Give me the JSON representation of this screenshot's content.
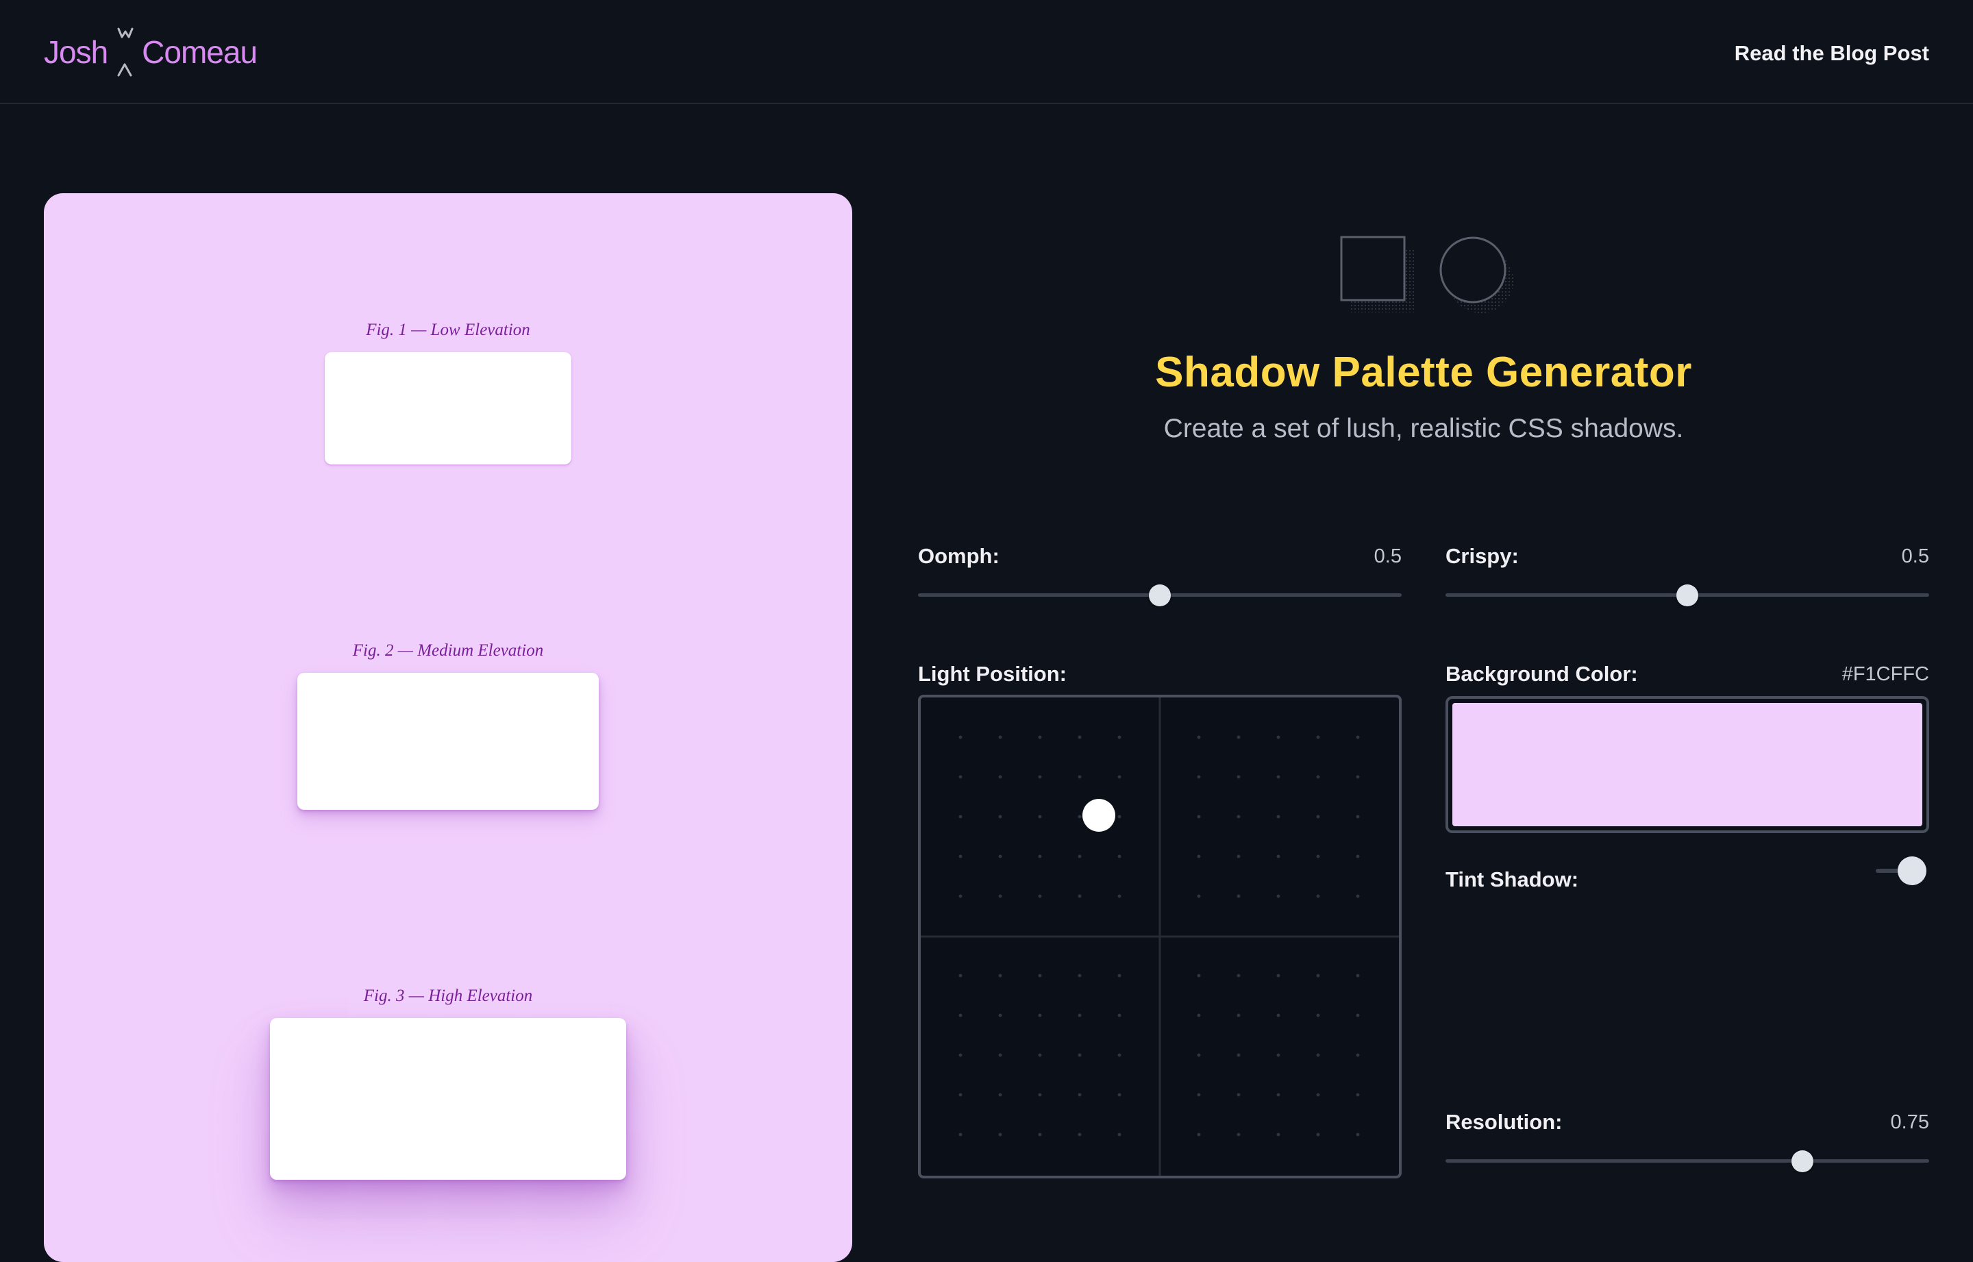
{
  "header": {
    "logo_first": "Josh",
    "logo_last": "Comeau",
    "nav_link": "Read the Blog Post"
  },
  "preview": {
    "background": "#F1CFFC",
    "figures": [
      {
        "caption": "Fig. 1 — Low Elevation"
      },
      {
        "caption": "Fig. 2 — Medium Elevation"
      },
      {
        "caption": "Fig. 3 — High Elevation"
      }
    ]
  },
  "hero": {
    "title": "Shadow Palette Generator",
    "subtitle": "Create a set of lush, realistic CSS shadows.",
    "icons": [
      "square-shadow-icon",
      "circle-shadow-icon"
    ]
  },
  "controls": {
    "oomph": {
      "label": "Oomph:",
      "value": "0.5"
    },
    "crispy": {
      "label": "Crispy:",
      "value": "0.5"
    },
    "light_position": {
      "label": "Light Position:"
    },
    "background_color": {
      "label": "Background Color:",
      "value": "#F1CFFC"
    },
    "tint_shadow": {
      "label": "Tint Shadow:",
      "enabled": true
    },
    "resolution": {
      "label": "Resolution:",
      "value": "0.75"
    }
  },
  "colors": {
    "accent": "#ffd84a",
    "brand": "#d98af2",
    "page_bg": "#0e121b"
  }
}
